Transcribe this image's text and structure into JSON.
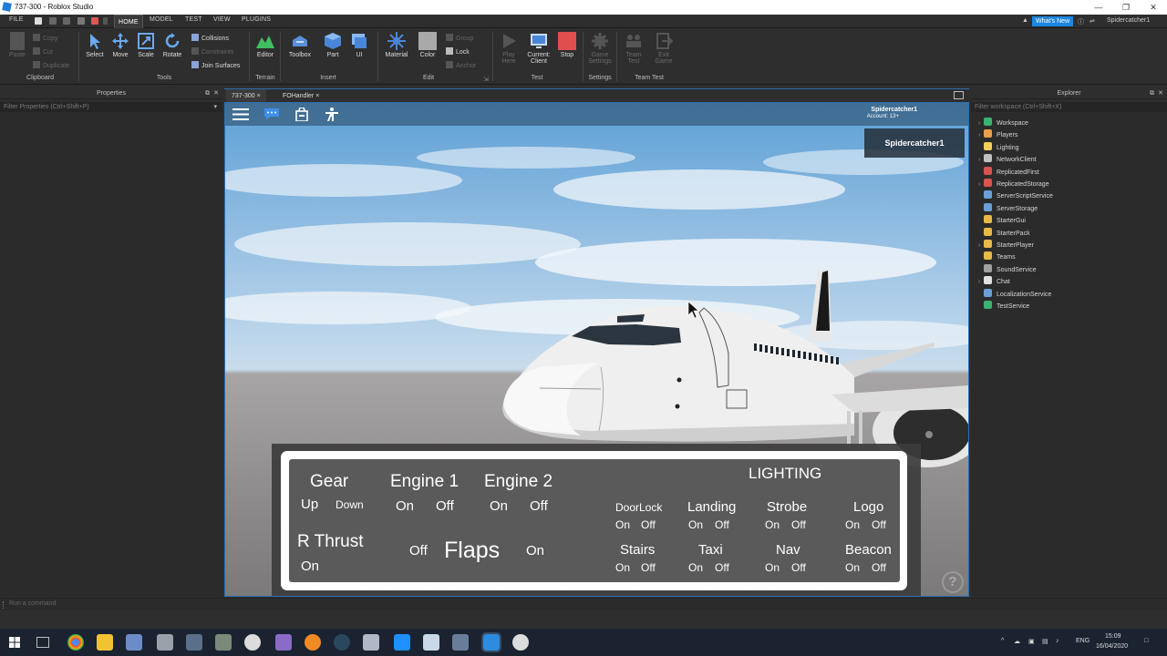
{
  "window": {
    "title": "737-300 - Roblox Studio",
    "controls": {
      "minimize": "—",
      "restore": "❐",
      "close": "✕"
    }
  },
  "menubar": {
    "file": "FILE",
    "tabs": [
      "HOME",
      "MODEL",
      "TEST",
      "VIEW",
      "PLUGINS"
    ],
    "whats_new": "What's New",
    "user": "Spidercatcher1"
  },
  "ribbon": {
    "clipboard": {
      "paste": "Paste",
      "copy": "Copy",
      "cut": "Cut",
      "duplicate": "Duplicate",
      "label": "Clipboard"
    },
    "tools": {
      "select": "Select",
      "move": "Move",
      "scale": "Scale",
      "rotate": "Rotate",
      "collisions": "Collisions",
      "constraints": "Constraints",
      "join_surfaces": "Join Surfaces",
      "label": "Tools"
    },
    "terrain": {
      "editor": "Editor",
      "label": "Terrain"
    },
    "insert": {
      "toolbox": "Toolbox",
      "part": "Part",
      "ui": "UI",
      "label": "Insert"
    },
    "edit": {
      "material": "Material",
      "color": "Color",
      "group": "Group",
      "lock": "Lock",
      "anchor": "Anchor",
      "label": "Edit"
    },
    "test": {
      "play_here": "Play Here",
      "current_client": "Current: Client",
      "stop": "Stop",
      "label": "Test"
    },
    "settings": {
      "game_settings": "Game Settings",
      "label": "Settings"
    },
    "team_test": {
      "team_test": "Team Test",
      "exit_game": "Exit Game",
      "label": "Team Test"
    }
  },
  "properties_panel": {
    "title": "Properties",
    "filter_placeholder": "Filter Properties (Ctrl+Shift+P)"
  },
  "explorer_panel": {
    "title": "Explorer",
    "filter_placeholder": "Filter workspace (Ctrl+Shift+X)",
    "items": [
      {
        "label": "Workspace",
        "expandable": true,
        "icon_color": "#3cb371"
      },
      {
        "label": "Players",
        "expandable": true,
        "icon_color": "#e8a04a"
      },
      {
        "label": "Lighting",
        "expandable": false,
        "icon_color": "#f2d15a"
      },
      {
        "label": "NetworkClient",
        "expandable": true,
        "icon_color": "#c0c0c0"
      },
      {
        "label": "ReplicatedFirst",
        "expandable": false,
        "icon_color": "#d9534f"
      },
      {
        "label": "ReplicatedStorage",
        "expandable": true,
        "icon_color": "#d9534f"
      },
      {
        "label": "ServerScriptService",
        "expandable": false,
        "icon_color": "#6aa0d6"
      },
      {
        "label": "ServerStorage",
        "expandable": false,
        "icon_color": "#6aa0d6"
      },
      {
        "label": "StarterGui",
        "expandable": false,
        "icon_color": "#e8b84a"
      },
      {
        "label": "StarterPack",
        "expandable": false,
        "icon_color": "#e8b84a"
      },
      {
        "label": "StarterPlayer",
        "expandable": true,
        "icon_color": "#e8b84a"
      },
      {
        "label": "Teams",
        "expandable": false,
        "icon_color": "#e8b84a"
      },
      {
        "label": "SoundService",
        "expandable": false,
        "icon_color": "#a0a0a0"
      },
      {
        "label": "Chat",
        "expandable": true,
        "icon_color": "#e0e0e0"
      },
      {
        "label": "LocalizationService",
        "expandable": false,
        "icon_color": "#6aa0d6"
      },
      {
        "label": "TestService",
        "expandable": false,
        "icon_color": "#3cb371"
      }
    ]
  },
  "document_tabs": [
    {
      "label": "737-300",
      "close": "×"
    },
    {
      "label": "FOHandler",
      "close": "×"
    }
  ],
  "game_view": {
    "account_name": "Spidercatcher1",
    "account_age": "Account: 13+",
    "playerlist_name": "Spidercatcher1",
    "help": "?"
  },
  "cockpit_gui": {
    "gear": {
      "title": "Gear",
      "up": "Up",
      "down": "Down"
    },
    "engine1": {
      "title": "Engine 1",
      "on": "On",
      "off": "Off"
    },
    "engine2": {
      "title": "Engine 2",
      "on": "On",
      "off": "Off"
    },
    "rthrust": {
      "title": "R Thrust",
      "on": "On"
    },
    "flaps": {
      "title": "Flaps",
      "off": "Off",
      "on": "On"
    },
    "lighting_title": "LIGHTING",
    "lights": [
      {
        "name": "DoorLock",
        "on": "On",
        "off": "Off"
      },
      {
        "name": "Landing",
        "on": "On",
        "off": "Off"
      },
      {
        "name": "Strobe",
        "on": "On",
        "off": "Off"
      },
      {
        "name": "Logo",
        "on": "On",
        "off": "Off"
      },
      {
        "name": "Stairs",
        "on": "On",
        "off": "Off"
      },
      {
        "name": "Taxi",
        "on": "On",
        "off": "Off"
      },
      {
        "name": "Nav",
        "on": "On",
        "off": "Off"
      },
      {
        "name": "Beacon",
        "on": "On",
        "off": "Off"
      }
    ]
  },
  "command_bar": {
    "placeholder": "Run a command"
  },
  "taskbar": {
    "lang": "ENG",
    "time": "15:09",
    "date": "16/04/2020"
  }
}
